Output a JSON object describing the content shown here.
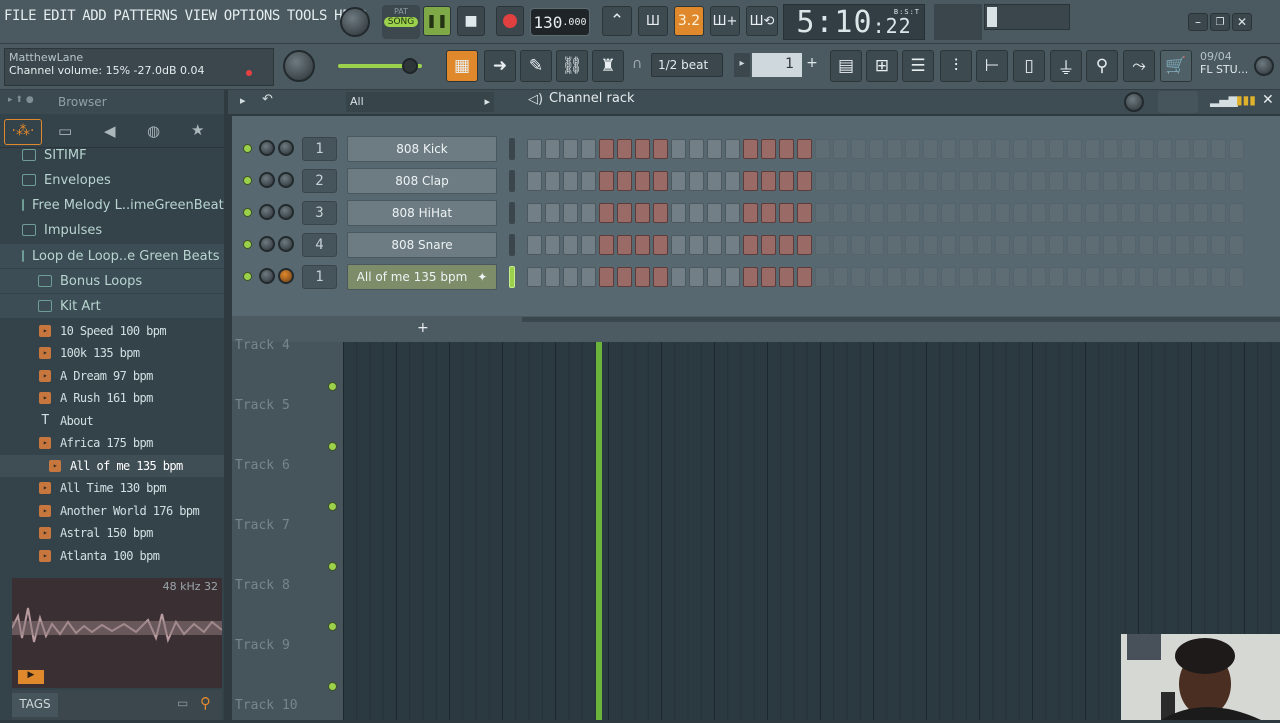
{
  "menu": [
    "FILE",
    "EDIT",
    "ADD",
    "PATTERNS",
    "VIEW",
    "OPTIONS",
    "TOOLS",
    "HELP"
  ],
  "transport": {
    "pat_label": "PAT",
    "song_label": "SONG",
    "tempo_int": "130",
    "tempo_dec": ".000",
    "pattern_size": "3.2"
  },
  "clock": {
    "main": "5:10",
    "sub": ":22",
    "tag": "B:S:T"
  },
  "hint": {
    "user": "MatthewLane",
    "status": "Channel volume: 15%  -27.0dB  0.04"
  },
  "snap": "1/2 beat",
  "pattern_num": "1",
  "news": {
    "date": "09/04",
    "title": "FL STU..."
  },
  "browser": {
    "title": "Browser",
    "folders": [
      {
        "label": "SITIMF"
      },
      {
        "label": "Envelopes"
      },
      {
        "label": "Free Melody L..imeGreenBeats"
      },
      {
        "label": "Impulses"
      },
      {
        "label": "Loop de Loop..e Green Beats"
      },
      {
        "label": "Bonus Loops"
      },
      {
        "label": "Kit Art"
      }
    ],
    "files": [
      "10 Speed 100 bpm",
      "100k 135 bpm",
      "A Dream 97 bpm",
      "A Rush 161 bpm",
      "About",
      "Africa 175 bpm",
      "All of me 135 bpm",
      "All Time 130 bpm",
      "Another World 176 bpm",
      "Astral 150 bpm",
      "Atlanta 100 bpm"
    ],
    "sample_info": "48 kHz 32",
    "tags_label": "TAGS"
  },
  "channel_rack": {
    "title": "Channel rack",
    "filter": "All",
    "channels": [
      {
        "num": "1",
        "name": "808 Kick"
      },
      {
        "num": "2",
        "name": "808 Clap"
      },
      {
        "num": "3",
        "name": "808 HiHat"
      },
      {
        "num": "4",
        "name": "808 Snare"
      },
      {
        "num": "1",
        "name": "All of me 135 bpm"
      }
    ]
  },
  "playlist": {
    "tracks": [
      "Track 4",
      "Track 5",
      "Track 6",
      "Track 7",
      "Track 8",
      "Track 9",
      "Track 10"
    ]
  }
}
